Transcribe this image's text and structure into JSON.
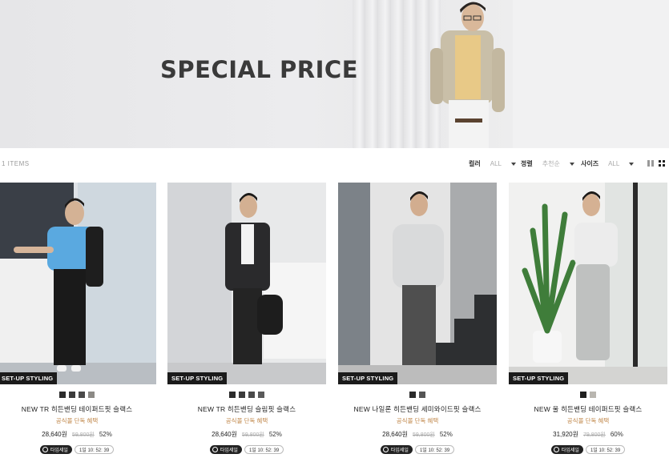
{
  "banner": {
    "title": "SPECIAL PRICE"
  },
  "toolbar": {
    "count": "1 ITEMS",
    "filters": [
      {
        "label": "컬러",
        "value": "ALL"
      },
      {
        "label": "정렬",
        "value": "추천순"
      },
      {
        "label": "사이즈",
        "value": "ALL"
      }
    ],
    "views": [
      "list-view-icon",
      "grid-view-icon"
    ]
  },
  "products": [
    {
      "badge": "SET-UP STYLING",
      "swatches": [
        "#2b2b2b",
        "#3b3b3b",
        "#4a4a4a",
        "#8c8a86"
      ],
      "name": "NEW TR 히든밴딩 테이퍼드핏 슬랙스",
      "promo": "공식몰 단독 혜택",
      "price": "28,640원",
      "original_price": "59,800원",
      "discount": "52%",
      "timer_label": "타임세일",
      "timer_value": "1일 10: 52: 39"
    },
    {
      "badge": "SET-UP STYLING",
      "swatches": [
        "#2b2b2b",
        "#3b3b3b",
        "#4a4a4a",
        "#5a5a5a"
      ],
      "name": "NEW TR 히든밴딩 슬림핏 슬랙스",
      "promo": "공식몰 단독 혜택",
      "price": "28,640원",
      "original_price": "59,800원",
      "discount": "52%",
      "timer_label": "타임세일",
      "timer_value": "1일 10: 52: 39"
    },
    {
      "badge": "SET-UP STYLING",
      "swatches": [
        "#2b2b2b",
        "#555555"
      ],
      "name": "NEW 나일론 히든밴딩 세미와이드핏 슬랙스",
      "promo": "공식몰 단독 혜택",
      "price": "28,640원",
      "original_price": "59,800원",
      "discount": "52%",
      "timer_label": "타임세일",
      "timer_value": "1일 10: 52: 39"
    },
    {
      "badge": "SET-UP STYLING",
      "swatches": [
        "#1f1f1f",
        "#b9b6b0"
      ],
      "name": "NEW 울 히든밴딩 테이퍼드핏 슬랙스",
      "promo": "공식몰 단독 혜택",
      "price": "31,920원",
      "original_price": "79,800원",
      "discount": "60%",
      "timer_label": "타임세일",
      "timer_value": "1일 10: 52: 39"
    }
  ]
}
